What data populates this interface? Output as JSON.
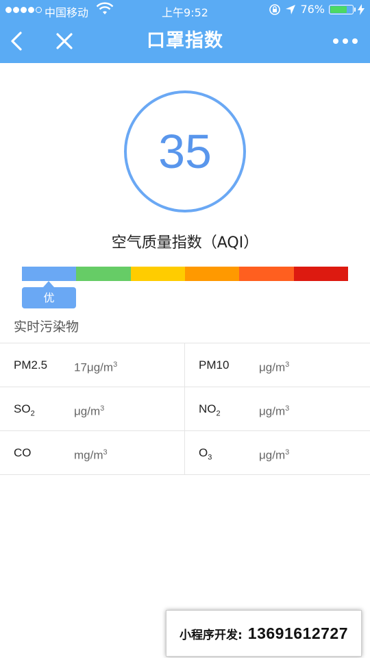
{
  "status_bar": {
    "carrier": "中国移动",
    "time": "上午9:52",
    "battery": "76%",
    "battery_level": 0.76,
    "signal_bars_filled": 4,
    "signal_bars_total": 5
  },
  "nav": {
    "title": "口罩指数",
    "icons": [
      "back-icon",
      "close-icon",
      "more-icon"
    ]
  },
  "aqi": {
    "value": "35",
    "label": "空气质量指数（AQI）",
    "level": "优",
    "scale_colors": [
      "#6aa8f4",
      "#66cc66",
      "#ffcc00",
      "#ff9900",
      "#ff5f1f",
      "#dd1a10"
    ],
    "ring_color": "#6aa8f4"
  },
  "pollutants": {
    "title": "实时污染物",
    "rows": [
      [
        {
          "name": "PM2.5",
          "value": "17",
          "unit": "μg/m",
          "unit_exp": "3"
        },
        {
          "name": "PM10",
          "value": "",
          "unit": "μg/m",
          "unit_exp": "3"
        }
      ],
      [
        {
          "name": "SO",
          "name_sub": "2",
          "value": "",
          "unit": "μg/m",
          "unit_exp": "3"
        },
        {
          "name": "NO",
          "name_sub": "2",
          "value": "",
          "unit": "μg/m",
          "unit_exp": "3"
        }
      ],
      [
        {
          "name": "CO",
          "value": "",
          "unit": "mg/m",
          "unit_exp": "3"
        },
        {
          "name": "O",
          "name_sub": "3",
          "value": "",
          "unit": "μg/m",
          "unit_exp": "3"
        }
      ]
    ]
  },
  "ad_banner": {
    "label": "小程序开发:",
    "phone": "13691612727"
  },
  "colors": {
    "nav_bg": "#5aabf4",
    "aqi_text": "#5996ec"
  }
}
